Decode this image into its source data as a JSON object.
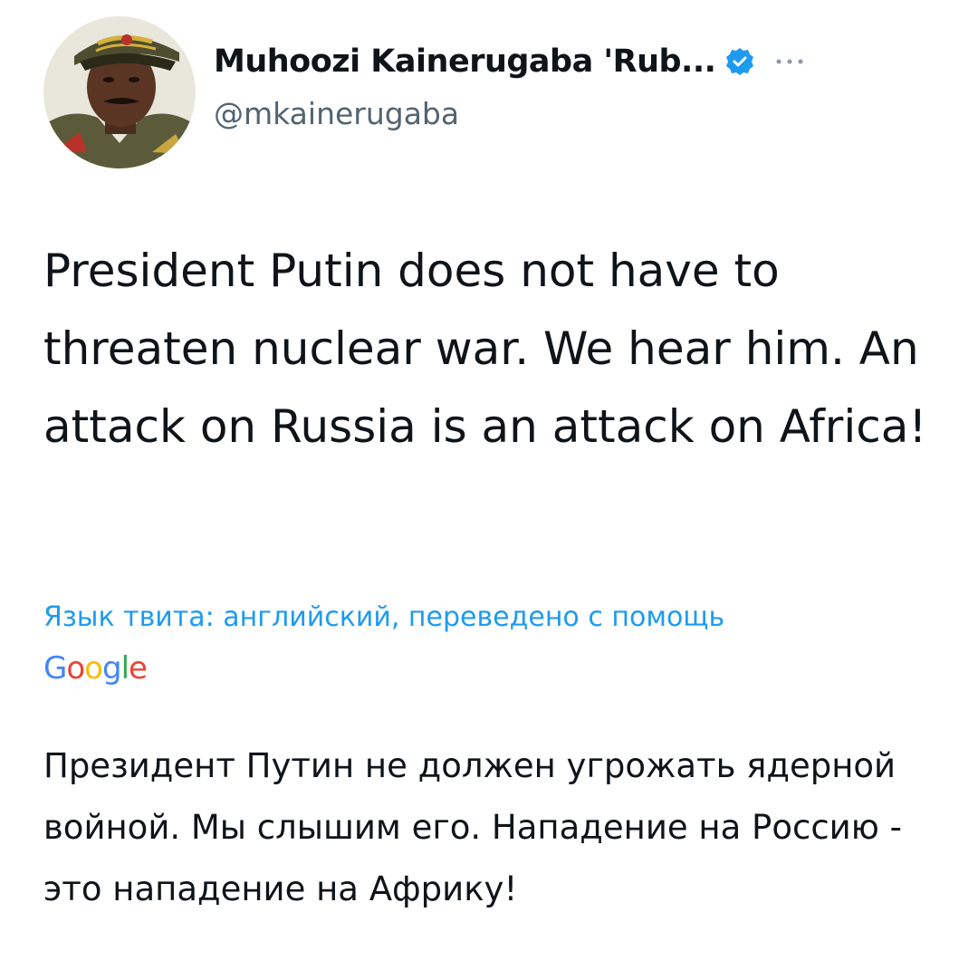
{
  "tweet": {
    "author": {
      "display_name": "Muhoozi Kainerugaba 'Rub...",
      "handle": "@mkainerugaba",
      "verified": true,
      "avatar_icon": "avatar-photo"
    },
    "text": "President Putin does not have to threaten nuclear war. We hear him. An attack on Russia is an attack on Africa!",
    "translation": {
      "label": "Язык твита: английский, переведено с помощь",
      "provider_letters": [
        "G",
        "o",
        "o",
        "g",
        "l",
        "e"
      ],
      "provider_colors": [
        "#4285F4",
        "#EA4335",
        "#FBBC05",
        "#4285F4",
        "#34A853",
        "#EA4335"
      ],
      "text": "Президент Путин не должен угрожать ядерной войной. Мы слышим его. Нападение на Россию - это нападение на Африку!"
    },
    "more_icon": "more-horizontal-icon",
    "colors": {
      "link": "#1d9bf0",
      "secondary_text": "#536471",
      "verified": "#1d9bf0"
    }
  }
}
